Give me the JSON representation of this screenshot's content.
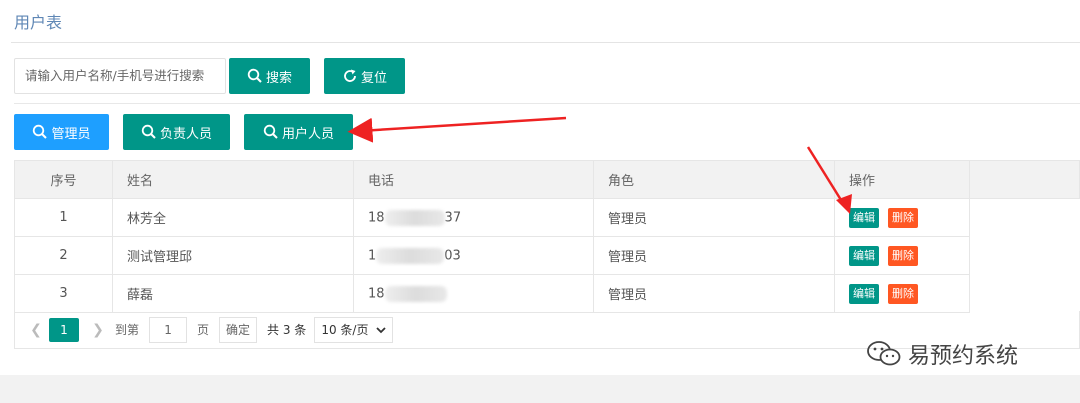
{
  "header": {
    "title": "用户表"
  },
  "search": {
    "placeholder": "请输入用户名称/手机号进行搜索",
    "search_label": "搜索",
    "reset_label": "复位"
  },
  "filters": [
    {
      "label": "管理员",
      "color": "#1e9fff"
    },
    {
      "label": "负责人员",
      "color": "#009688"
    },
    {
      "label": "用户人员",
      "color": "#009688"
    }
  ],
  "table": {
    "headers": [
      "序号",
      "姓名",
      "电话",
      "角色",
      "操作"
    ],
    "rows": [
      {
        "index": "1",
        "name": "林芳全",
        "phone_prefix": "18",
        "phone_suffix": "37",
        "role": "管理员"
      },
      {
        "index": "2",
        "name": "测试管理邱",
        "phone_prefix": "1",
        "phone_suffix": "03",
        "role": "管理员"
      },
      {
        "index": "3",
        "name": "薛磊",
        "phone_prefix": "18",
        "phone_suffix": "",
        "role": "管理员"
      }
    ],
    "edit_label": "编辑",
    "delete_label": "删除"
  },
  "pagination": {
    "current_page": "1",
    "goto_prefix": "到第",
    "goto_value": "1",
    "goto_suffix": "页",
    "confirm_label": "确定",
    "total_text": "共 3 条",
    "page_size": "10 条/页"
  },
  "watermark": {
    "text": "易预约系统"
  },
  "colors": {
    "accent": "#009688",
    "primary": "#1e9fff",
    "danger": "#ff5722",
    "arrow": "#ee2222"
  }
}
